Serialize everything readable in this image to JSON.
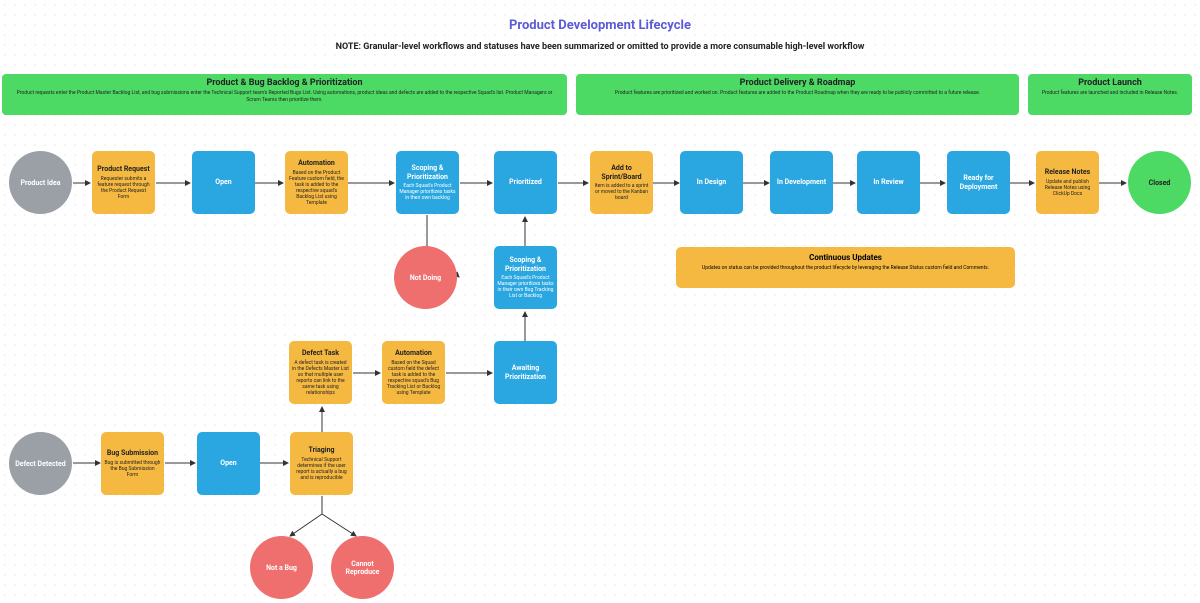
{
  "title": "Product Development Lifecycle",
  "subtitle": "NOTE: Granular-level workflows and statuses have been summarized or omitted to provide a more consumable high-level workflow",
  "phases": {
    "p1": {
      "title": "Product & Bug Backlog & Prioritization",
      "desc": "Product requests enter the Product Master Backlog List, and bug submissions enter the Technical Support team's Reported Bugs List. Using automations, product ideas and defects are added to the respective Squad's list. Product Managers or Scrum Teams then prioritize them."
    },
    "p2": {
      "title": "Product Delivery & Roadmap",
      "desc": "Product features are prioritized and worked on. Product features are added to the Product Roadmap when they are ready to be publicly committed to a future release."
    },
    "p3": {
      "title": "Product Launch",
      "desc": "Product features are launched and included in Release Notes."
    }
  },
  "circles": {
    "idea": "Product Idea",
    "defect": "Defect Detected",
    "closed": "Closed",
    "notbug": "Not a Bug",
    "cannot": "Cannot Reproduce",
    "notdoing": "Not Doing"
  },
  "nodes": {
    "prodreq": {
      "t": "Product Request",
      "d": "Requester submits a feature request through the Product Request Form"
    },
    "open1": {
      "t": "Open",
      "d": ""
    },
    "auto1": {
      "t": "Automation",
      "d": "Based on the Product Feature custom field, the task is added to the respective squad's Backlog List using Template"
    },
    "scope1": {
      "t": "Scoping & Prioritization",
      "d": "Each Squad's Product Manager prioritizes tasks in their own backlog"
    },
    "prio": {
      "t": "Prioritized",
      "d": ""
    },
    "addsp": {
      "t": "Add to Sprint/Board",
      "d": "Item is added to a sprint or moved to the Kanban board"
    },
    "design": {
      "t": "In Design",
      "d": ""
    },
    "dev": {
      "t": "In Development",
      "d": ""
    },
    "review": {
      "t": "In Review",
      "d": ""
    },
    "ready": {
      "t": "Ready for Deployment",
      "d": ""
    },
    "release": {
      "t": "Release Notes",
      "d": "Update and publish Release Notes using ClickUp Docs"
    },
    "scope2": {
      "t": "Scoping & Prioritization",
      "d": "Each Squad's Product Manager prioritizes tasks in their own Bug Tracking List or Backlog"
    },
    "defectT": {
      "t": "Defect Task",
      "d": "A defect task is created in the Defects Master List so that multiple user reports can link to the same task using relationships"
    },
    "auto2": {
      "t": "Automation",
      "d": "Based on the Squad custom field the defect task is added to the respective squad's Bug Tracking List or Backlog using Template"
    },
    "await": {
      "t": "Awaiting Prioritization",
      "d": ""
    },
    "bugsub": {
      "t": "Bug Submission",
      "d": "Bug is submitted through the Bug Submission Form"
    },
    "open2": {
      "t": "Open",
      "d": ""
    },
    "triage": {
      "t": "Triaging",
      "d": "Technical Support determines if the user report is actually a bug and is reproducible"
    }
  },
  "band": {
    "title": "Continuous Updates",
    "desc": "Updates on status can be provided throughout the product lifecycle by leveraging the Release Status custom field and Comments."
  }
}
